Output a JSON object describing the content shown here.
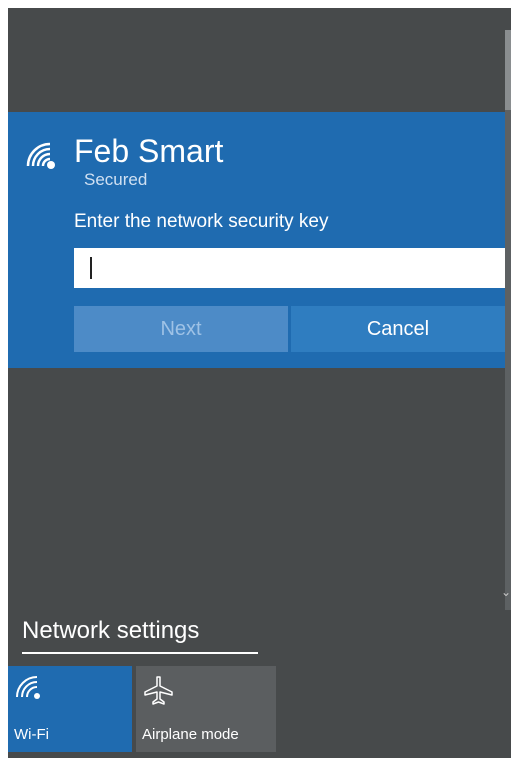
{
  "network": {
    "ssid": "Feb Smart",
    "status": "Secured",
    "prompt": "Enter the network security key",
    "key_value": "",
    "next_label": "Next",
    "cancel_label": "Cancel",
    "icon": "wifi-secured-icon"
  },
  "settings": {
    "label": "Network settings"
  },
  "quick_actions": [
    {
      "label": "Wi-Fi",
      "icon": "wifi-icon",
      "active": true
    },
    {
      "label": "Airplane mode",
      "icon": "airplane-icon",
      "active": false
    }
  ],
  "colors": {
    "panel_bg": "#474a4b",
    "accent": "#1f6bb0",
    "button_disabled": "#4d8bc7",
    "button_cancel": "#2f7dc0",
    "tile_inactive": "#5b5e60"
  }
}
